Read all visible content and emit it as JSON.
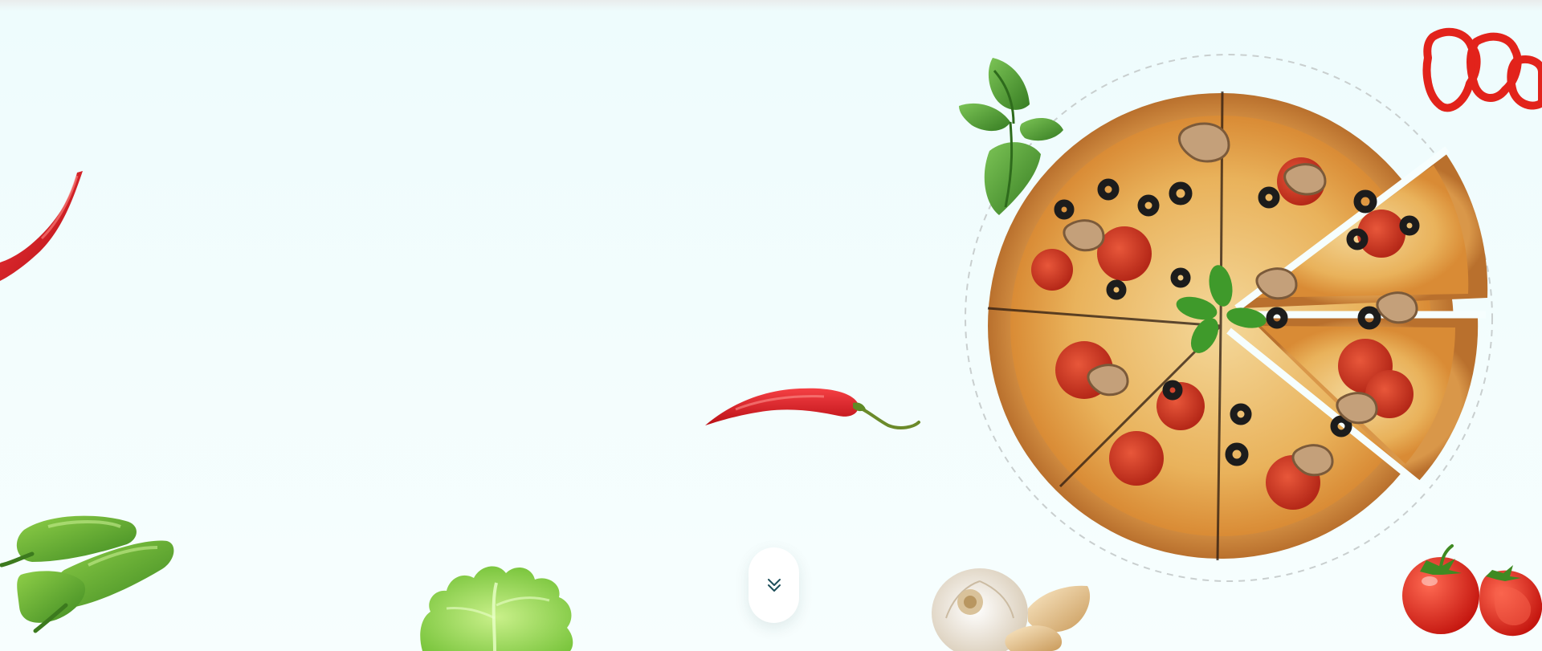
{
  "page": {
    "background_color": "#eefcfd",
    "accent_color": "#1d4e5a"
  },
  "scroll_down_button": {
    "icon": "double-chevron-down-icon",
    "background_color": "#ffffff",
    "icon_color": "#1d4e5a"
  },
  "decorations": [
    {
      "name": "red-chili-pepper-left-image",
      "color": "#d3141c"
    },
    {
      "name": "red-chili-pepper-center-image",
      "color": "#d3141c"
    },
    {
      "name": "green-peppers-image",
      "color": "#5ea52c"
    },
    {
      "name": "lettuce-leaf-image",
      "color": "#8fd64a"
    },
    {
      "name": "garlic-image",
      "color": "#efe4d2"
    },
    {
      "name": "mint-leaves-image",
      "color": "#4d9b34"
    },
    {
      "name": "red-bell-pepper-rings-image",
      "color": "#e4231c"
    },
    {
      "name": "tomatoes-image",
      "color": "#e0261b"
    },
    {
      "name": "pizza-image",
      "color": "#d08a3a"
    }
  ]
}
